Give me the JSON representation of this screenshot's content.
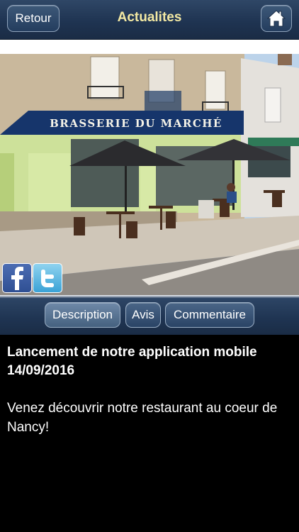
{
  "navbar": {
    "back_label": "Retour",
    "title": "Actualites",
    "home_icon": "home-icon"
  },
  "photo": {
    "sign_text": "BRASSERIE DU MARCHÉ"
  },
  "social": {
    "facebook_icon": "facebook-icon",
    "twitter_icon": "twitter-icon"
  },
  "tabs": {
    "description": "Description",
    "avis": "Avis",
    "commentaire": "Commentaire",
    "active": "description"
  },
  "article": {
    "title_line1": "Lancement de notre application mobile",
    "date": "14/09/2016",
    "body": "Venez découvrir notre restaurant au coeur de Nancy!"
  },
  "colors": {
    "nav_bg": "#1f3452",
    "title_color": "#f3e9a3",
    "content_bg": "#000000"
  }
}
